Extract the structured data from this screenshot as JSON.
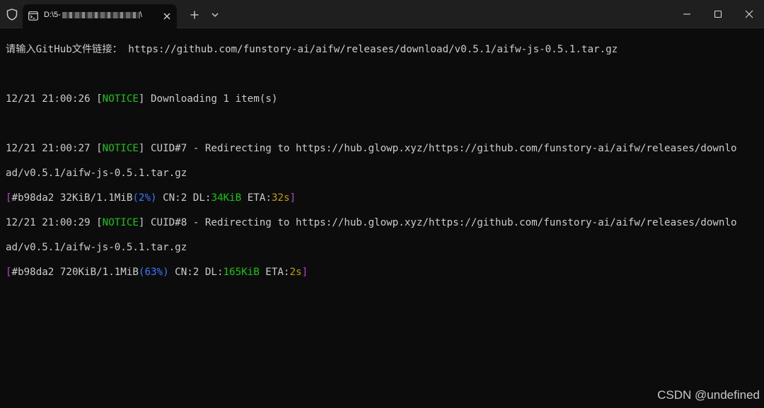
{
  "window": {
    "tab_title_prefix": "D:\\5-",
    "tab_title_suffix": "\\",
    "icons": {
      "shield": "shield-icon",
      "tab": "terminal-tab-icon",
      "close_tab": "close-icon",
      "new_tab": "plus-icon",
      "dropdown": "chevron-down-icon",
      "minimize": "minimize-icon",
      "maximize": "maximize-icon",
      "close_window": "close-icon"
    }
  },
  "terminal": {
    "prompt": "请输入GitHub文件链接：",
    "prompt_url": " https://github.com/funstory-ai/aifw/releases/download/v0.5.1/aifw-js-0.5.1.tar.gz",
    "log1": {
      "time": "12/21 21:00:26 ",
      "lb": "[",
      "tag": "NOTICE",
      "rb": "]",
      "msg": " Downloading 1 item(s)"
    },
    "log2": {
      "time": "12/21 21:00:27 ",
      "lb": "[",
      "tag": "NOTICE",
      "rb": "]",
      "msg_line1": " CUID#7 - Redirecting to https://hub.glowp.xyz/https://github.com/funstory-ai/aifw/releases/downlo",
      "msg_line2": "ad/v0.5.1/aifw-js-0.5.1.tar.gz"
    },
    "progress1": {
      "open": "[",
      "gid": "#b98da2 32KiB/1.1MiB",
      "pct": "(2%)",
      "cn": " CN:2 DL:",
      "dl": "34KiB",
      "eta_label": " ETA:",
      "eta": "32s",
      "close": "]"
    },
    "log3": {
      "time": "12/21 21:00:29 ",
      "lb": "[",
      "tag": "NOTICE",
      "rb": "]",
      "msg_line1": " CUID#8 - Redirecting to https://hub.glowp.xyz/https://github.com/funstory-ai/aifw/releases/downlo",
      "msg_line2": "ad/v0.5.1/aifw-js-0.5.1.tar.gz"
    },
    "progress2": {
      "open": "[",
      "gid": "#b98da2 720KiB/1.1MiB",
      "pct": "(63%)",
      "cn": " CN:2 DL:",
      "dl": "165KiB",
      "eta_label": " ETA:",
      "eta": "2s",
      "close": "]"
    }
  },
  "watermark": "CSDN @undefined",
  "colors": {
    "background": "#0c0c0c",
    "titlebar": "#1f1f1f",
    "text": "#cccccc",
    "notice_green": "#16c60c",
    "percent_blue": "#3b78ff",
    "bracket_purple": "#b148c6",
    "eta_yellow": "#c19c00"
  }
}
